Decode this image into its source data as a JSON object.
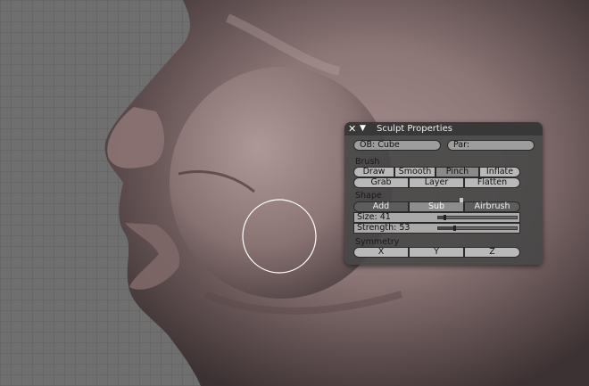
{
  "panel": {
    "title": "Sculpt Properties",
    "close_icon": "x-icon",
    "collapse_icon": "triangle-down-icon",
    "object_field": "OB: Cube",
    "parent_field": "Par:"
  },
  "brush": {
    "label": "Brush",
    "row1": [
      "Draw",
      "Smooth",
      "Pinch",
      "Inflate"
    ],
    "row2": [
      "Grab",
      "Layer",
      "Flatten"
    ],
    "active": "Pinch"
  },
  "shape": {
    "label": "Shape",
    "buttons": [
      "Add",
      "Sub",
      "Airbrush"
    ],
    "active": "Sub"
  },
  "sliders": {
    "size_label": "Size: 41",
    "size_fraction": 0.41,
    "strength_label": "Strength: 53",
    "strength_fraction": 0.53
  },
  "symmetry": {
    "label": "Symmetry",
    "buttons": [
      "X",
      "Y",
      "Z"
    ]
  },
  "colors": {
    "background": "#6f6f6f",
    "grid": "#5f5f5f",
    "skin": "#8c7474",
    "brush_circle": "#ffffff",
    "panel_bg": "#464646"
  }
}
